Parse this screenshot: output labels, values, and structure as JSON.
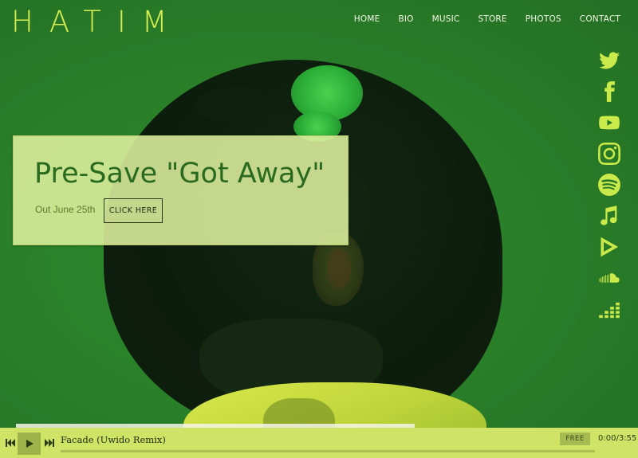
{
  "brand": {
    "logo": "HATIM",
    "accent_color": "#d8ee55"
  },
  "nav": {
    "items": [
      "HOME",
      "BIO",
      "MUSIC",
      "STORE",
      "PHOTOS",
      "CONTACT"
    ]
  },
  "socials": [
    "twitter-icon",
    "facebook-icon",
    "youtube-icon",
    "instagram-icon",
    "spotify-icon",
    "itunes-icon",
    "google-play-icon",
    "soundcloud-icon",
    "deezer-icon"
  ],
  "promo": {
    "title": "Pre-Save \"Got Away\"",
    "subtitle": "Out June 25th",
    "button_label": "CLICK HERE"
  },
  "player": {
    "track_title": "Facade (Uwido Remix)",
    "badge": "FREE",
    "time": "0:00/3:55",
    "progress": 0
  }
}
